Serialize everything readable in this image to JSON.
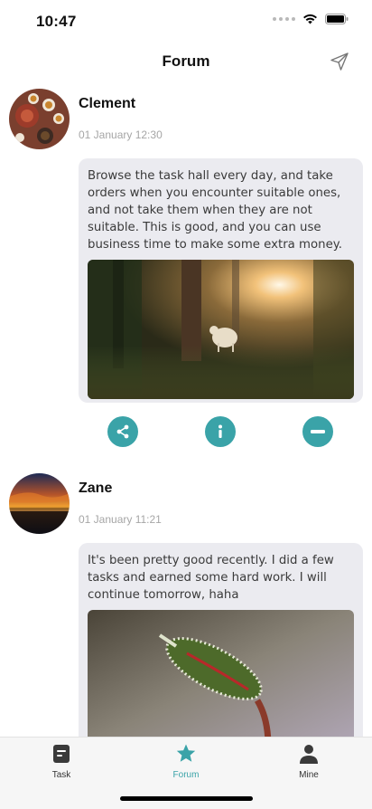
{
  "status_bar": {
    "time": "10:47"
  },
  "nav": {
    "title": "Forum",
    "send_icon": "send-icon"
  },
  "posts": [
    {
      "author": "Clement",
      "timestamp": "01 January 12:30",
      "text": "Browse the task hall every day, and take orders when you encounter suitable ones, and not take them when they are not suitable. This is good, and you can use business time to make some extra money.",
      "avatar": "tea-set-photo",
      "image": "forest-lamb-photo"
    },
    {
      "author": "Zane",
      "timestamp": "01 January 11:21",
      "text": "It's been pretty good recently. I did a few tasks and earned some hard work. I will continue tomorrow, haha",
      "avatar": "sunset-sea-photo",
      "image": "frosted-bud-photo"
    }
  ],
  "actions": {
    "share_icon": "share-icon",
    "info_icon": "info-icon",
    "remove_icon": "minus-circle-icon"
  },
  "tabs": [
    {
      "label": "Task",
      "icon": "task-doc-icon"
    },
    {
      "label": "Forum",
      "icon": "star-icon",
      "active": true
    },
    {
      "label": "Mine",
      "icon": "person-icon"
    }
  ],
  "colors": {
    "accent": "#3aa3a8",
    "bubble": "#ebebf0",
    "timestamp": "#a6a6a6"
  }
}
